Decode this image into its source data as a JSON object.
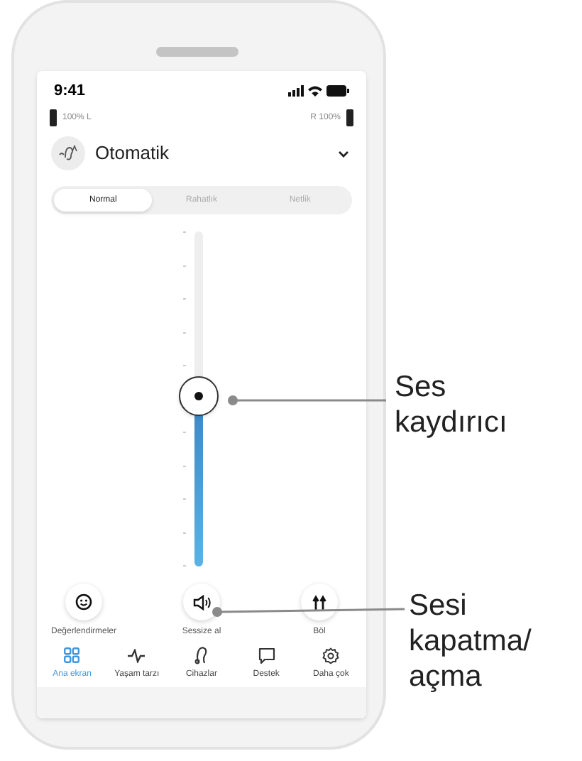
{
  "status_bar": {
    "time": "9:41"
  },
  "batteries": {
    "left": "100% L",
    "right": "R 100%"
  },
  "program": {
    "label": "Otomatik"
  },
  "segments": [
    {
      "label": "Normal",
      "selected": true
    },
    {
      "label": "Rahatlık",
      "selected": false
    },
    {
      "label": "Netlik",
      "selected": false
    }
  ],
  "volume_slider": {
    "level": 0.51
  },
  "actions": [
    {
      "kind": "rate",
      "label": "Değerlendirmeler"
    },
    {
      "kind": "mute",
      "label": "Sessize al"
    },
    {
      "kind": "split",
      "label": "Böl"
    }
  ],
  "nav": [
    {
      "kind": "home",
      "label": "Ana ekran",
      "selected": true
    },
    {
      "kind": "lifestyle",
      "label": "Yaşam tarzı",
      "selected": false
    },
    {
      "kind": "devices",
      "label": "Cihazlar",
      "selected": false
    },
    {
      "kind": "support",
      "label": "Destek",
      "selected": false
    },
    {
      "kind": "more",
      "label": "Daha çok",
      "selected": false
    }
  ],
  "callouts": [
    {
      "kind": "slider",
      "text": "Ses kaydırıcı"
    },
    {
      "kind": "mute",
      "text": "Sesi kapatma/ açma"
    }
  ]
}
